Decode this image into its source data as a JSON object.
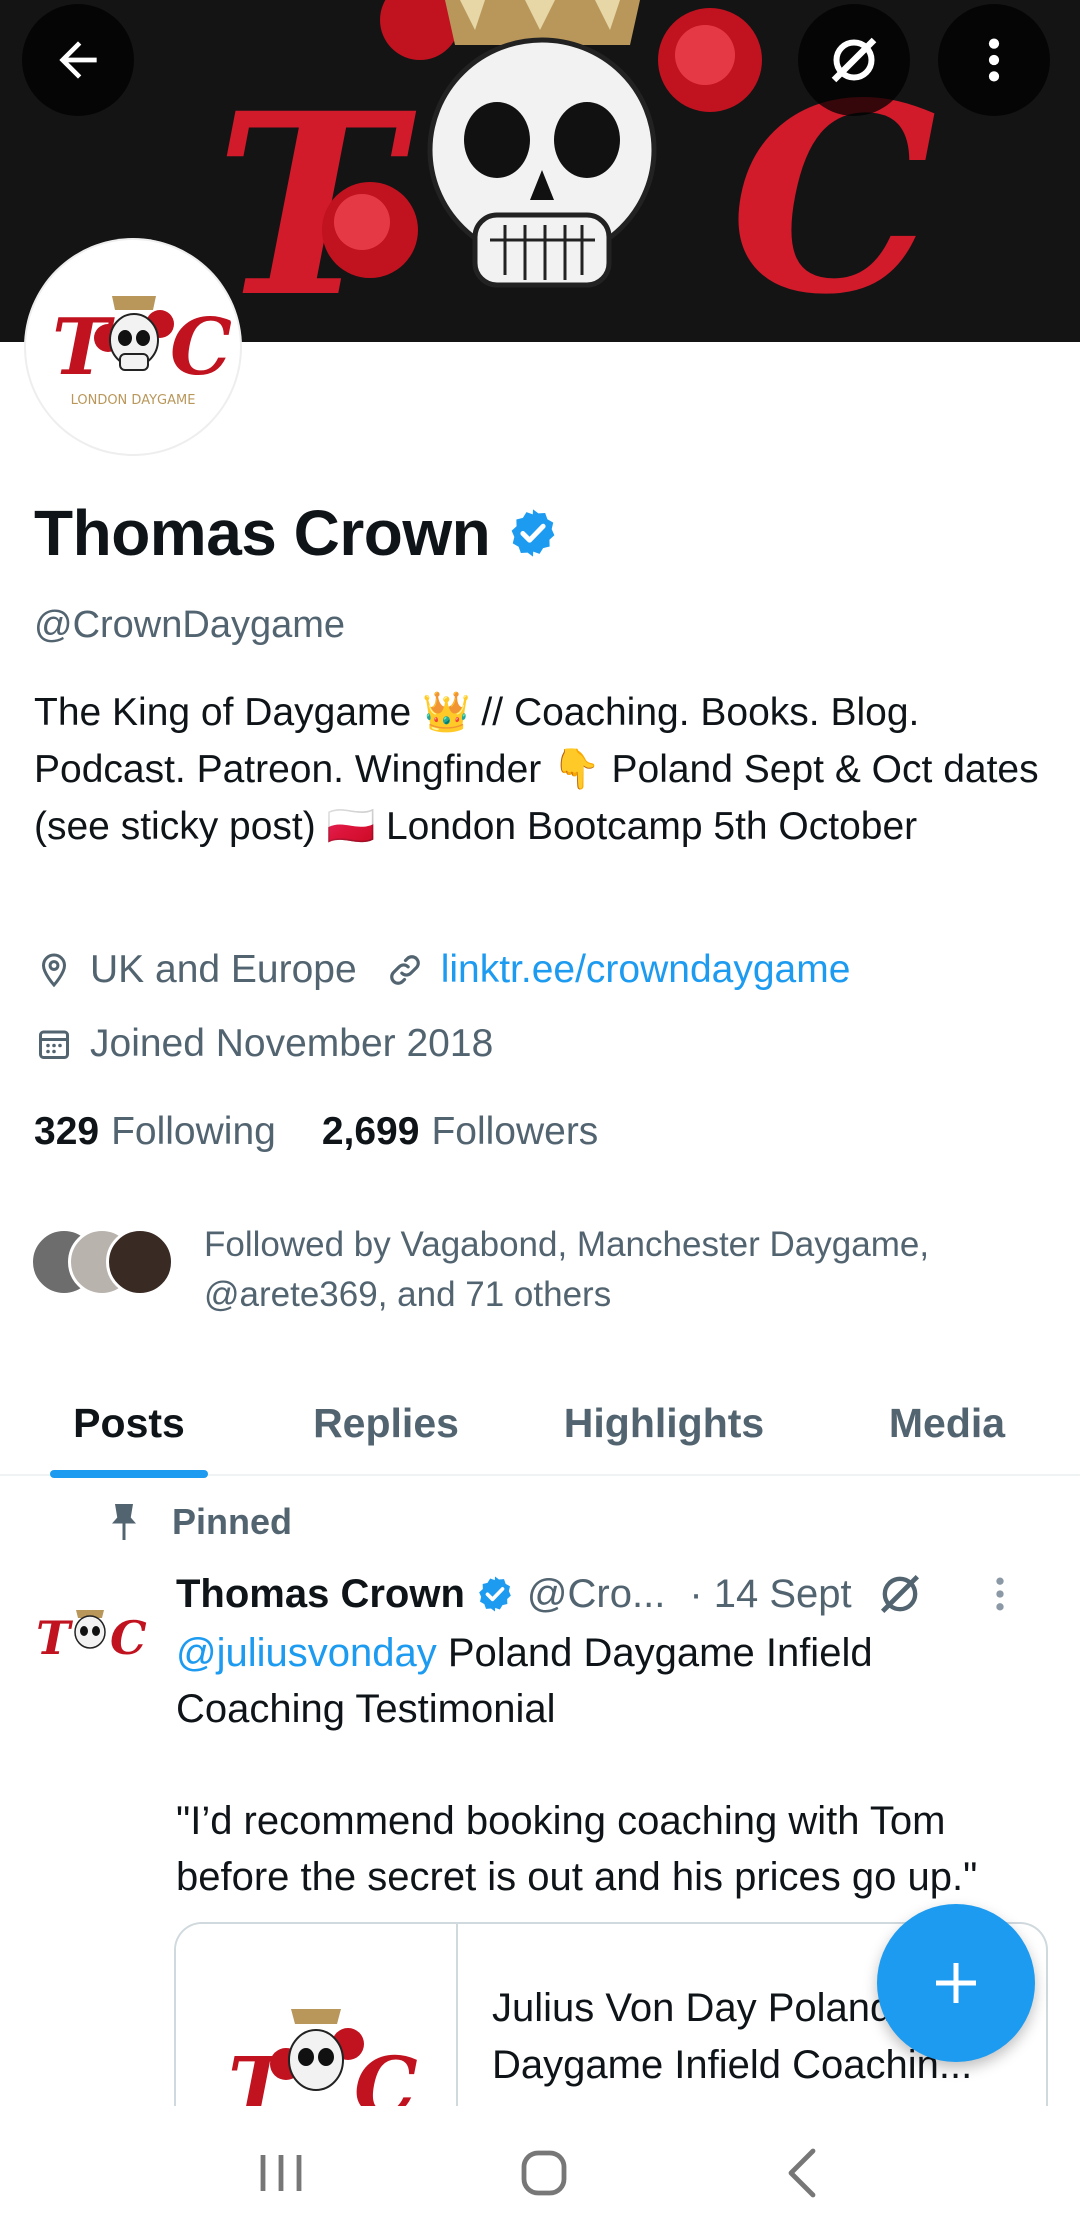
{
  "banner": {
    "letter_left": "T",
    "letter_right": "C"
  },
  "avatar": {
    "caption": "LONDON DAYGAME"
  },
  "profile": {
    "name": "Thomas Crown",
    "handle": "@CrownDaygame",
    "bio": "The King of Daygame 👑 // Coaching. Books. Blog. Podcast. Patreon. Wingfinder 👇 Poland Sept & Oct dates (see sticky post) 🇵🇱 London Bootcamp 5th October",
    "location": "UK and Europe",
    "website": "linktr.ee/crowndaygame",
    "joined": "Joined November 2018",
    "following_count": "329",
    "following_label": "Following",
    "followers_count": "2,699",
    "followers_label": "Followers",
    "followed_by": "Followed by Vagabond, Manchester Daygame, @arete369, and 71 others"
  },
  "tabs": [
    {
      "label": "Posts",
      "active": true
    },
    {
      "label": "Replies",
      "active": false
    },
    {
      "label": "Highlights",
      "active": false
    },
    {
      "label": "Media",
      "active": false
    }
  ],
  "pinned_post": {
    "pinned_label": "Pinned",
    "author": "Thomas Crown",
    "handle": "@Cro...",
    "date": "· 14 Sept",
    "mention": "@juliusvonday",
    "text_after_mention": " Poland Daygame Infield Coaching Testimonial\n\n\"I’d recommend booking coaching with Tom before the secret is out and his prices go up.\"",
    "card_title": "Julius Von Day Poland Daygame Infield Coachin..."
  },
  "colors": {
    "accent": "#1d9bf0",
    "text_primary": "#0f1419",
    "text_secondary": "#536471",
    "banner_red": "#d11a2a"
  },
  "icons": {
    "back": "arrow-left-icon",
    "grok": "grok-icon",
    "more": "more-vertical-icon",
    "verified": "verified-badge-icon",
    "location": "location-pin-icon",
    "link": "link-icon",
    "calendar": "calendar-icon",
    "pin": "pin-icon",
    "compose": "plus-icon"
  }
}
